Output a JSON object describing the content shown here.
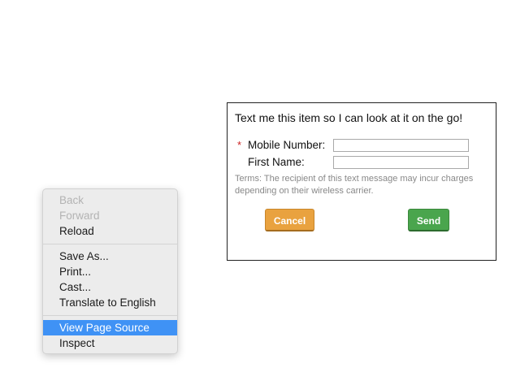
{
  "dialog": {
    "title": "Text me this item so I can look at it on the go!",
    "required_marker": "*",
    "mobile_label": "Mobile Number:",
    "mobile_value": "",
    "first_name_label": "First Name:",
    "first_name_value": "",
    "terms": "Terms: The recipient of this text message may incur charges depending on their wireless carrier.",
    "cancel_label": "Cancel",
    "send_label": "Send",
    "colors": {
      "required": "#cc2222",
      "cancel": "#e9a23f",
      "send": "#4aa54d",
      "terms_text": "#888888"
    }
  },
  "context_menu": {
    "items": [
      {
        "label": "Back",
        "enabled": false
      },
      {
        "label": "Forward",
        "enabled": false
      },
      {
        "label": "Reload",
        "enabled": true
      },
      {
        "label": "Save As...",
        "enabled": true
      },
      {
        "label": "Print...",
        "enabled": true
      },
      {
        "label": "Cast...",
        "enabled": true
      },
      {
        "label": "Translate to English",
        "enabled": true
      },
      {
        "label": "View Page Source",
        "enabled": true,
        "highlighted": true
      },
      {
        "label": "Inspect",
        "enabled": true
      }
    ],
    "colors": {
      "highlight": "#3f92f5",
      "disabled_text": "#b3b3b3"
    }
  }
}
